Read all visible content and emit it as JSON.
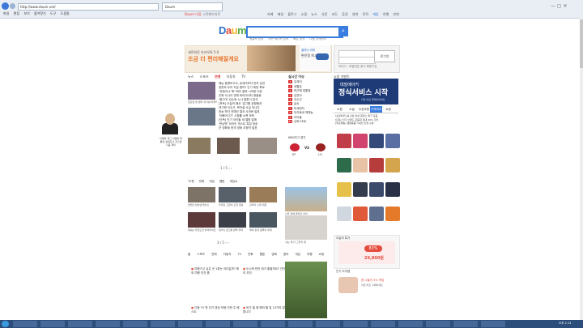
{
  "browser": {
    "address": "http://www.daum.net/",
    "tab_title": "Daum",
    "menu": [
      "파일",
      "편집",
      "보기",
      "즐겨찾기",
      "도구",
      "도움말"
    ]
  },
  "util": {
    "daum_link": "Daum 다음",
    "start_link": "시작페이지로",
    "links": [
      "카페",
      "메일",
      "블로그",
      "쇼핑",
      "뉴스",
      "사전",
      "지도",
      "증권",
      "영화",
      "뮤직",
      "게임",
      "여행",
      "만화"
    ],
    "highlight": "게임"
  },
  "logo": {
    "d": "D",
    "a": "a",
    "u": "u",
    "m": "m"
  },
  "search": {
    "placeholder": "",
    "button_icon": "search-icon",
    "links": [
      "원클릭 검색",
      "모든 메이커 검색",
      "빠른 검색",
      "다음 검색센터"
    ]
  },
  "ad_main": {
    "line1": "새로워진 카카오톡 5.0",
    "line2": "조금 더 편리해질게요",
    "side_line1": "클래식 리퍼",
    "side_line2": "편안함 최고 발"
  },
  "login": {
    "button": "로그인",
    "links": "아이디 · 비밀번호 찾기  회원가입"
  },
  "news": {
    "tabs": [
      "뉴스",
      "스포츠",
      "연예",
      "자동차",
      "TV"
    ],
    "active": "연예",
    "lines": [
      "예능 동향보고서, 유재석보다 먼저 상견",
      "정준하 우리 지금 왕따? 인기 톡방 폭로",
      "\"운동이나 해\" 배우 알바 시작한 이유",
      "진짜 사나이 연예 버라이어티 총출동",
      "'별그대' 김수현 누나 결혼식 참석",
      "[포토] 오늘의 패션 '걸그룹 공항패션'",
      "개그맨 이수근, 복귀설 사실 아니다",
      "방송 하차 연예인 결국 사과문 발표",
      "'아빠어디가' 시청률 소폭 하락",
      "[단독] 인기 아이돌 새 앨범 발매",
      "'런닝맨' 외국인 게스트 특집 방송",
      "칸 영화제 한국 영화 초청작 발표"
    ],
    "thumb_caption": "금요일 밤 결국 과거를 떠올리는 사람",
    "pager": "1 / 5"
  },
  "realtime": {
    "title": "실시간 이슈",
    "items": [
      "유재석",
      "세월호",
      "박근혜 대통령",
      "김연아",
      "이수근",
      "날씨",
      "미세먼지",
      "우리동네 예체능",
      "아이돌",
      "슈퍼스타K"
    ]
  },
  "score": {
    "team_a": "KT",
    "team_b": "LG",
    "vs": "VS",
    "label": "KBO리그 경기"
  },
  "person_ad": {
    "caption": "이명박 개그 이명박 대통령 성대모사 개그맨 다음 재미"
  },
  "video": {
    "tabs": [
      "TV팟",
      "만화",
      "게임",
      "웹툰",
      "게임쇼"
    ],
    "captions": [
      "[클립] 런닝맨 레이스",
      "우리집 고양이 흔한 일상",
      "강아지 수영 대회",
      "[예능] 무한도전 하이라이트",
      "[뮤비] 걸그룹 컴백 무대",
      "해외 토픽 동물의 세계"
    ],
    "pager": "3 / 5",
    "photo_caption1": "나무 위에 올라간 아이",
    "photo_caption2": "사는 게 다 그렇지 뭐"
  },
  "bottom_tabs": [
    "홈",
    "스포츠",
    "연예",
    "자동차",
    "TV",
    "만화",
    "웹툰",
    "영화",
    "음악",
    "게임",
    "여행",
    "쇼핑"
  ],
  "qa": [
    "여행가고 싶은 곳 1위는 어디일까? 해외 여행 추천 좀",
    "도시락 반찬 뭐가 좋을까요? 간단한 요리 추천",
    "다음 TV 팟 인기 영상 모음 이번 주 베스트",
    "비가 올 때 해야 할 일 10가지 알려드립니다"
  ],
  "right": {
    "header": "쇼핑 이벤트",
    "banner_line1": "데빌메이커",
    "banner_line2": "정식서비스 시작",
    "banner_line3": "지금 바로 플레이하세요",
    "shop_tabs": [
      "쇼핑",
      "소셜",
      "오픈마켓",
      "가격비교",
      "쇼핑"
    ],
    "shop_lines": [
      "[쇼핑하우] 봄 신상 여성 원피스 특가 모음",
      "[단독] 인기 브랜드 운동화 최대 60% 할인",
      "[무료배송] 캠핑용품 기획전 한정 수량"
    ]
  },
  "coupon": {
    "header": "오늘의 특가",
    "percent": "83%",
    "price": "29,800원"
  },
  "bottom_right": {
    "header": "인기 아이템",
    "line1": "봄 나들이 5% 적립",
    "line2": "지금 바로 구매하세요"
  },
  "taskbar": {
    "clock": "오후 2:14"
  },
  "colors": {
    "accent": "#3a7de0",
    "daum_red": "#e34b3c",
    "banner": "#1e3b78"
  }
}
